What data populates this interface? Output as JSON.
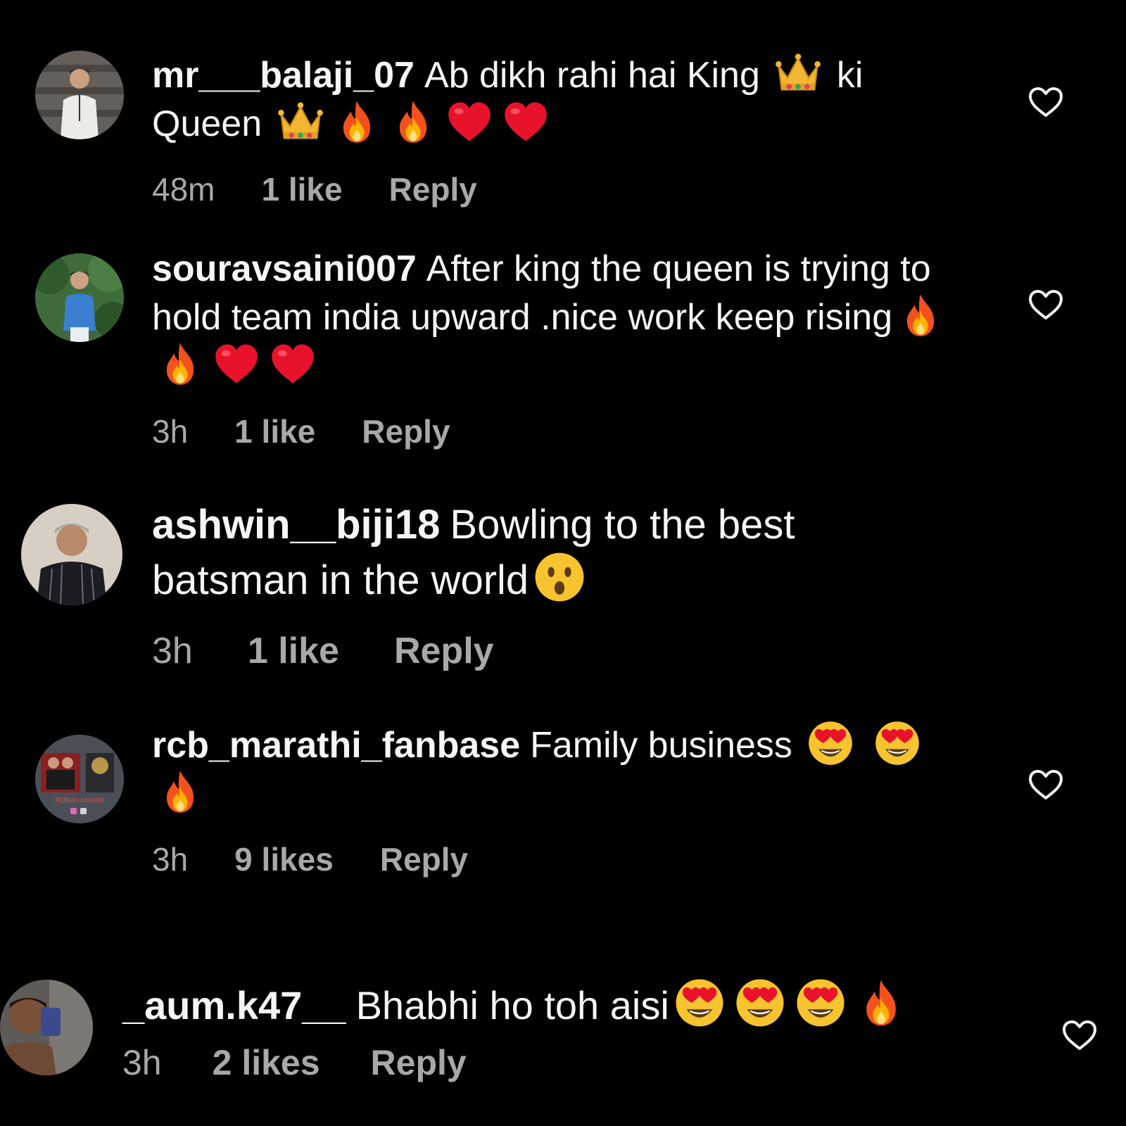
{
  "comments": [
    {
      "username": "mr___balaji_07",
      "text_a": "Ab dikh rahi hai King",
      "text_b": "ki",
      "text_c": "Queen",
      "time": "48m",
      "likes": "1 like",
      "reply": "Reply",
      "emojis": [
        "crown-emoji",
        "crown-emoji",
        "fire-emoji",
        "fire-emoji",
        "red-heart-emoji",
        "red-heart-emoji"
      ]
    },
    {
      "username": "souravsaini007",
      "text": "After king the queen is trying to hold team india upward .nice work keep rising",
      "time": "3h",
      "likes": "1 like",
      "reply": "Reply",
      "emojis": [
        "fire-emoji",
        "fire-emoji",
        "red-heart-emoji",
        "red-heart-emoji"
      ]
    },
    {
      "username": "ashwin__biji18",
      "text": "Bowling to the best batsman in the world",
      "time": "3h",
      "likes": "1 like",
      "reply": "Reply",
      "emojis": [
        "surprised-face-emoji"
      ]
    },
    {
      "username": "rcb_marathi_fanbase",
      "text": "Family business",
      "time": "3h",
      "likes": "9 likes",
      "reply": "Reply",
      "emojis": [
        "heart-eyes-emoji",
        "heart-eyes-emoji",
        "fire-emoji"
      ]
    },
    {
      "username": "_aum.k47__",
      "text": "Bhabhi ho toh aisi",
      "time": "3h",
      "likes": "2 likes",
      "reply": "Reply",
      "emojis": [
        "heart-eyes-emoji",
        "heart-eyes-emoji",
        "heart-eyes-emoji",
        "fire-emoji"
      ]
    }
  ],
  "avatar_texts": {
    "rcb_logo_text": "RCBIAN ASHISH"
  },
  "colors": {
    "background": "#000000",
    "text": "#f5f5f5",
    "meta": "#a8a8a8"
  }
}
